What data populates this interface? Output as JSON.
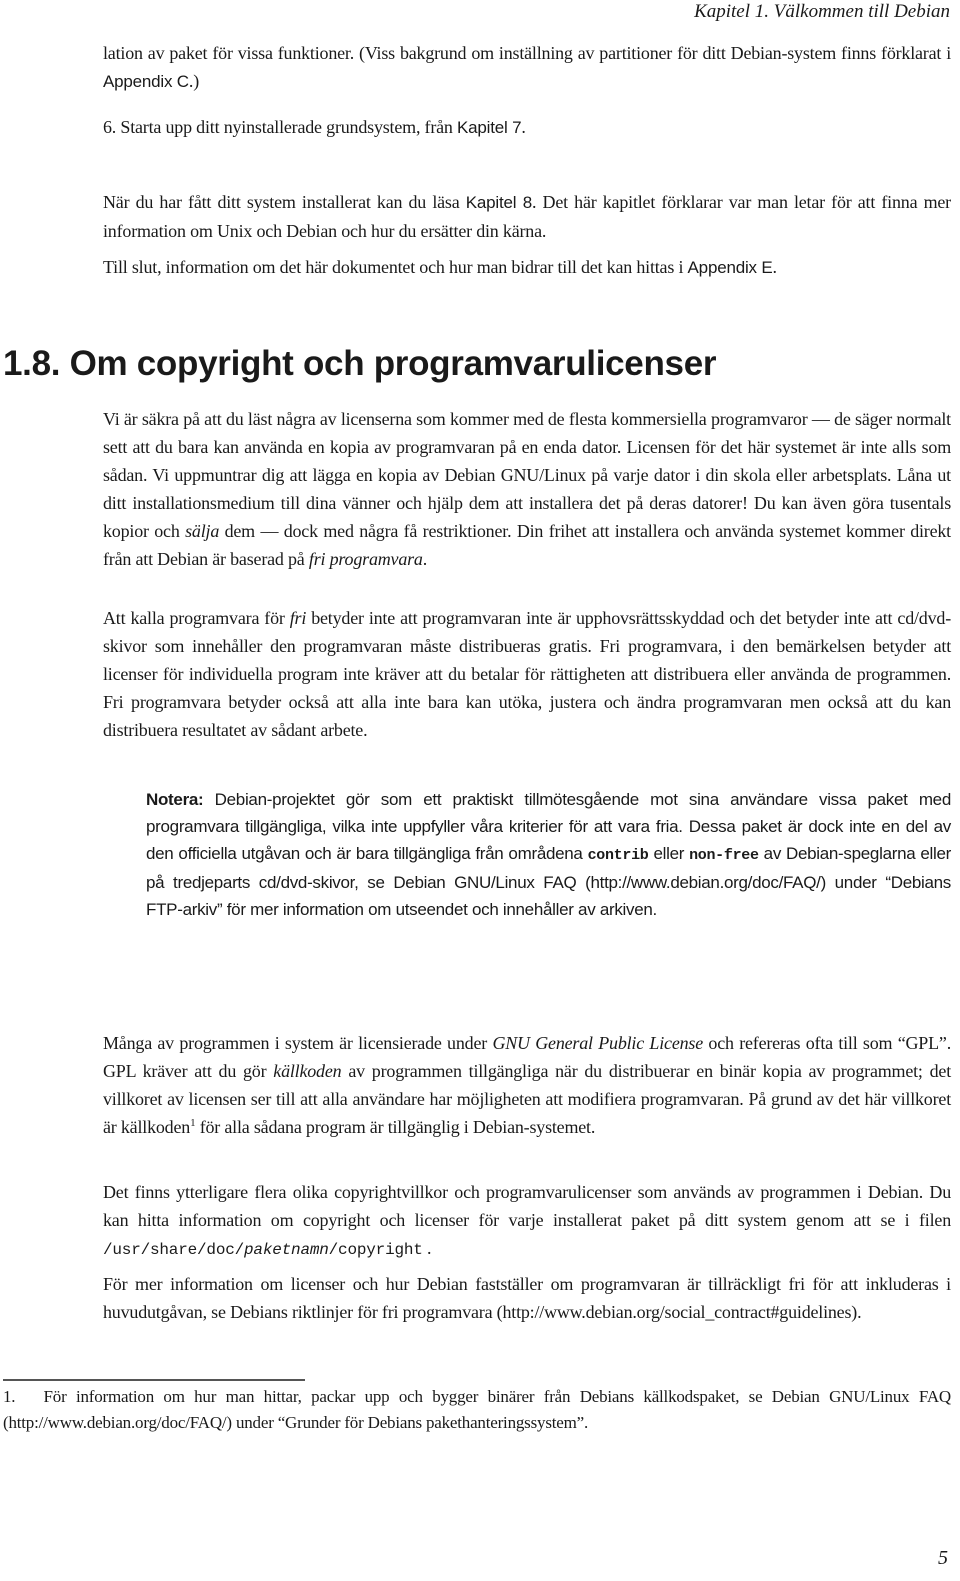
{
  "running_head": "Kapitel 1. Välkommen till Debian",
  "intro": {
    "p1_text": "lation av paket för vissa funktioner. (Viss bakgrund om inställning av partitioner för ditt Debian-system finns förklarat i ",
    "p1_link": "Appendix C",
    "p1_end": ".)",
    "item6_prefix": "6. Starta upp ditt nyinstallerade grundsystem, från ",
    "item6_link": "Kapitel 7",
    "item6_end": ".",
    "p2_prefix": "När du har fått ditt system installerat kan du läsa ",
    "p2_link": "Kapitel 8",
    "p2_rest": ". Det här kapitlet förklarar var man letar för att finna mer information om Unix och Debian och hur du ersätter din kärna.",
    "p3_prefix": "Till slut, information om det här dokumentet och hur man bidrar till det kan hittas i ",
    "p3_link": "Appendix E",
    "p3_end": "."
  },
  "section": {
    "heading": "1.8. Om copyright och programvarulicenser",
    "para1": {
      "a": "Vi är säkra på att du läst några av licenserna som kommer med de flesta kommersiella programvaror — de säger normalt sett att du bara kan använda en kopia av programvaran på en enda dator. Licensen för det här systemet är inte alls som sådan. Vi uppmuntrar dig att lägga en kopia av Debian GNU/Linux på varje dator i din skola eller arbetsplats. Låna ut ditt installationsmedium till dina vänner och hjälp dem att installera det på deras datorer! Du kan även göra tusentals kopior och ",
      "em1": "sälja",
      "b": " dem — dock med några få restriktioner. Din frihet att installera och använda systemet kommer direkt från att Debian är baserad på ",
      "em2": "fri programvara",
      "c": "."
    },
    "para2": {
      "a": "Att kalla programvara för ",
      "em1": "fri",
      "b": " betyder inte att programvaran inte är upphovsrättsskyddad och det betyder inte att cd/dvd-skivor som innehåller den programvaran måste distribueras gratis. Fri programvara, i den bemärkelsen betyder att licenser för individuella program inte kräver att du betalar för rättigheten att distribuera eller använda de programmen. Fri programvara betyder också att alla inte bara kan utöka, justera och ändra programvaran men också att du kan distribuera resultatet av sådant arbete."
    },
    "note": {
      "label": "Notera:",
      "a": " Debian-projektet gör som ett praktiskt tillmötesgående mot sina användare vissa paket med programvara tillgängliga, vilka inte uppfyller våra kriterier för att vara fria. Dessa paket är dock inte en del av den officiella utgåvan och är bara tillgängliga från områdena ",
      "code1": "contrib",
      "b": " eller ",
      "code2": "non-free",
      "c": " av Debian-speglarna eller på tredjeparts cd/dvd-skivor, se Debian GNU/Linux FAQ (http://www.debian.org/doc/FAQ/) under “Debians FTP-arkiv” för mer information om utseendet och innehåller av arkiven."
    },
    "para3": {
      "a": "Många av programmen i system är licensierade under ",
      "em1": "GNU General Public License",
      "b": " och refereras ofta till som “GPL”. GPL kräver att du gör ",
      "em2": "källkoden",
      "c": " av programmen tillgängliga när du distribuerar en binär kopia av programmet; det villkoret av licensen ser till att alla användare har möjligheten att modifiera programvaran. På grund av det här villkoret är källkoden",
      "fnref": "1",
      "d": " för alla sådana program är tillgänglig i Debian-systemet."
    },
    "para4": {
      "a": "Det finns ytterligare flera olika copyrightvillkor och programvarulicenser som används av programmen i Debian. Du kan hitta information om copyright och licenser för varje installerat paket på ditt system genom att se i filen ",
      "path1": "/usr/share/doc/",
      "path_em": "paketnamn",
      "path2": "/copyright",
      "b": " ."
    },
    "para5": {
      "a": "För mer information om licenser och hur Debian fastställer om programvaran är tillräckligt fri för att inkluderas i huvudutgåvan, se Debians riktlinjer för fri programvara (http://www.debian.org/social_contract#guidelines)."
    }
  },
  "footnote": {
    "number": "1.",
    "text": "För information om hur man hittar, packar upp och bygger binärer från Debians källkodspaket, se Debian GNU/Linux FAQ (http://www.debian.org/doc/FAQ/) under “Grunder för Debians pakethanteringssystem”."
  },
  "page_number": "5"
}
